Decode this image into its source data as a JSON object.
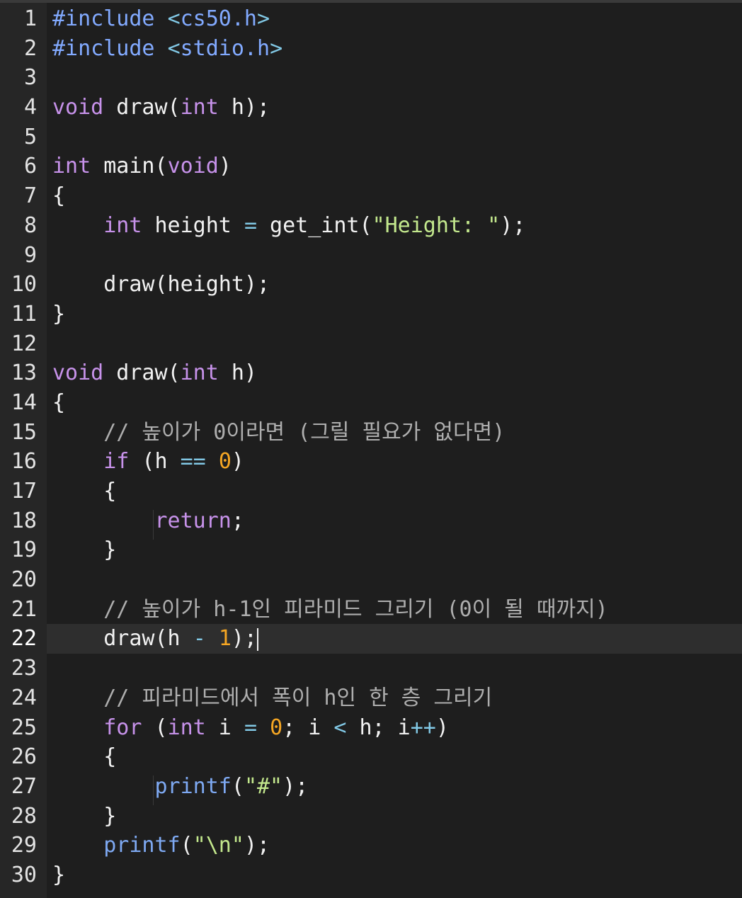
{
  "editor": {
    "active_line": 22,
    "lines": [
      {
        "n": "1",
        "t": [
          [
            "inc",
            "#include "
          ],
          [
            "op",
            "<"
          ],
          [
            "inc",
            "cs50.h"
          ],
          [
            "op",
            ">"
          ]
        ]
      },
      {
        "n": "2",
        "t": [
          [
            "inc",
            "#include "
          ],
          [
            "op",
            "<"
          ],
          [
            "inc",
            "stdio.h"
          ],
          [
            "op",
            ">"
          ]
        ]
      },
      {
        "n": "3",
        "t": []
      },
      {
        "n": "4",
        "t": [
          [
            "kw",
            "void"
          ],
          [
            "pl",
            " draw("
          ],
          [
            "ty",
            "int"
          ],
          [
            "pl",
            " h);"
          ]
        ]
      },
      {
        "n": "5",
        "t": []
      },
      {
        "n": "6",
        "t": [
          [
            "ty",
            "int"
          ],
          [
            "pl",
            " main("
          ],
          [
            "kw",
            "void"
          ],
          [
            "pl",
            ")"
          ]
        ]
      },
      {
        "n": "7",
        "t": [
          [
            "pl",
            "{"
          ]
        ]
      },
      {
        "n": "8",
        "t": [
          [
            "pl",
            "    "
          ],
          [
            "ty",
            "int"
          ],
          [
            "pl",
            " height "
          ],
          [
            "op",
            "="
          ],
          [
            "pl",
            " get_int("
          ],
          [
            "str",
            "\"Height: \""
          ],
          [
            "pl",
            ");"
          ]
        ]
      },
      {
        "n": "9",
        "t": []
      },
      {
        "n": "10",
        "t": [
          [
            "pl",
            "    draw(height);"
          ]
        ]
      },
      {
        "n": "11",
        "t": [
          [
            "pl",
            "}"
          ]
        ]
      },
      {
        "n": "12",
        "t": []
      },
      {
        "n": "13",
        "t": [
          [
            "kw",
            "void"
          ],
          [
            "pl",
            " draw("
          ],
          [
            "ty",
            "int"
          ],
          [
            "pl",
            " h)"
          ]
        ]
      },
      {
        "n": "14",
        "t": [
          [
            "pl",
            "{"
          ]
        ]
      },
      {
        "n": "15",
        "t": [
          [
            "pl",
            "    "
          ],
          [
            "cm",
            "// 높이가 0이라면 (그릴 필요가 없다면)"
          ]
        ]
      },
      {
        "n": "16",
        "t": [
          [
            "pl",
            "    "
          ],
          [
            "kw",
            "if"
          ],
          [
            "pl",
            " (h "
          ],
          [
            "op",
            "=="
          ],
          [
            "pl",
            " "
          ],
          [
            "num",
            "0"
          ],
          [
            "pl",
            ")"
          ]
        ]
      },
      {
        "n": "17",
        "t": [
          [
            "pl",
            "    {"
          ]
        ]
      },
      {
        "n": "18",
        "t": [
          [
            "pl",
            "        "
          ],
          [
            "kw",
            "return"
          ],
          [
            "pl",
            ";"
          ]
        ]
      },
      {
        "n": "19",
        "t": [
          [
            "pl",
            "    }"
          ]
        ]
      },
      {
        "n": "20",
        "t": []
      },
      {
        "n": "21",
        "t": [
          [
            "pl",
            "    "
          ],
          [
            "cm",
            "// 높이가 h-1인 피라미드 그리기 (0이 될 때까지)"
          ]
        ]
      },
      {
        "n": "22",
        "t": [
          [
            "pl",
            "    draw(h "
          ],
          [
            "op",
            "-"
          ],
          [
            "pl",
            " "
          ],
          [
            "num",
            "1"
          ],
          [
            "pl",
            ");"
          ]
        ]
      },
      {
        "n": "23",
        "t": []
      },
      {
        "n": "24",
        "t": [
          [
            "pl",
            "    "
          ],
          [
            "cm",
            "// 피라미드에서 폭이 h인 한 층 그리기"
          ]
        ]
      },
      {
        "n": "25",
        "t": [
          [
            "pl",
            "    "
          ],
          [
            "kw",
            "for"
          ],
          [
            "pl",
            " ("
          ],
          [
            "ty",
            "int"
          ],
          [
            "pl",
            " i "
          ],
          [
            "op",
            "="
          ],
          [
            "pl",
            " "
          ],
          [
            "num",
            "0"
          ],
          [
            "pl",
            "; i "
          ],
          [
            "op",
            "<"
          ],
          [
            "pl",
            " h; i"
          ],
          [
            "op",
            "++"
          ],
          [
            "pl",
            ")"
          ]
        ]
      },
      {
        "n": "26",
        "t": [
          [
            "pl",
            "    {"
          ]
        ]
      },
      {
        "n": "27",
        "t": [
          [
            "pl",
            "        "
          ],
          [
            "fn",
            "printf"
          ],
          [
            "pl",
            "("
          ],
          [
            "str",
            "\"#\""
          ],
          [
            "pl",
            ");"
          ]
        ]
      },
      {
        "n": "28",
        "t": [
          [
            "pl",
            "    }"
          ]
        ]
      },
      {
        "n": "29",
        "t": [
          [
            "pl",
            "    "
          ],
          [
            "fn",
            "printf"
          ],
          [
            "pl",
            "("
          ],
          [
            "str",
            "\"\\n\""
          ],
          [
            "pl",
            ");"
          ]
        ]
      },
      {
        "n": "30",
        "t": [
          [
            "pl",
            "}"
          ]
        ]
      }
    ]
  }
}
